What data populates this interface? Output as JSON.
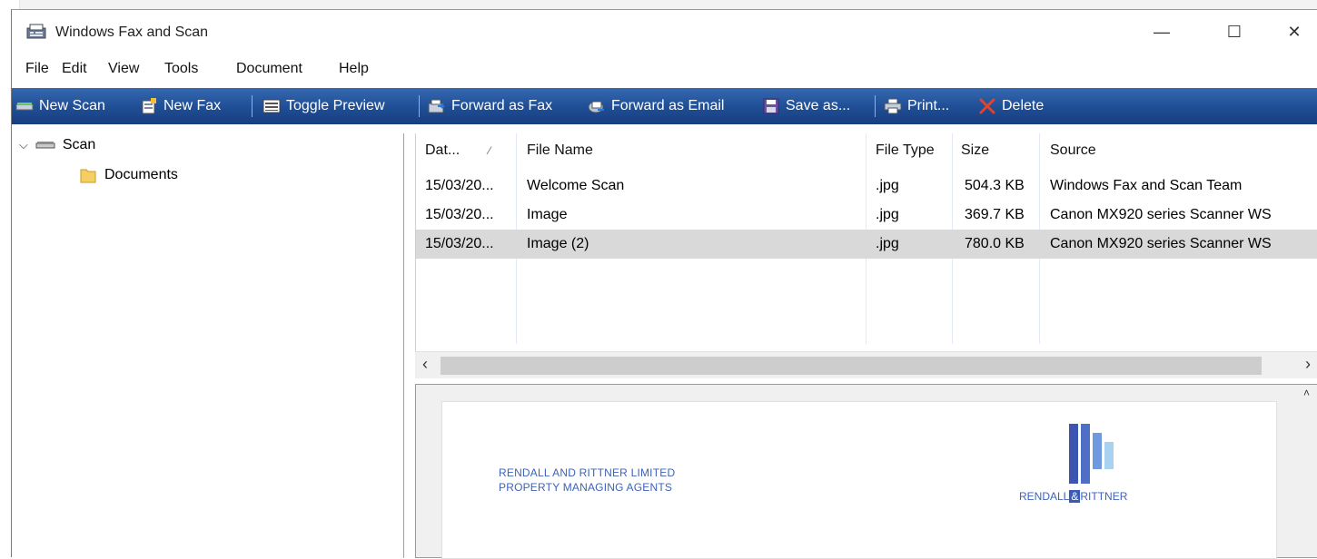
{
  "window": {
    "title": "Windows Fax and Scan"
  },
  "menu": [
    "File",
    "Edit",
    "View",
    "Tools",
    "Document",
    "Help"
  ],
  "toolbar": {
    "new_scan": "New Scan",
    "new_fax": "New Fax",
    "toggle_preview": "Toggle Preview",
    "forward_fax": "Forward as Fax",
    "forward_email": "Forward as Email",
    "save_as": "Save as...",
    "print": "Print...",
    "delete": "Delete"
  },
  "tree": {
    "root": "Scan",
    "child": "Documents"
  },
  "list": {
    "columns": [
      "Dat...",
      "File Name",
      "File Type",
      "Size",
      "Source"
    ],
    "rows": [
      {
        "date": "15/03/20...",
        "name": "Welcome Scan",
        "type": ".jpg",
        "size": "504.3 KB",
        "source": "Windows Fax and Scan Team"
      },
      {
        "date": "15/03/20...",
        "name": "Image",
        "type": ".jpg",
        "size": "369.7 KB",
        "source": "Canon MX920 series Scanner WS"
      },
      {
        "date": "15/03/20...",
        "name": "Image (2)",
        "type": ".jpg",
        "size": "780.0 KB",
        "source": "Canon MX920 series Scanner WS"
      }
    ],
    "selected_row": 2
  },
  "preview": {
    "company_line1": "RENDALL AND RITTNER LIMITED",
    "company_line2": "PROPERTY MANAGING AGENTS",
    "brand_left": "RENDALL",
    "brand_amp": "&",
    "brand_right": "RITTNER"
  },
  "colors": {
    "toolbar": "#1f4d94",
    "selection": "#d9d9d9",
    "brand": "#3e63b8"
  }
}
